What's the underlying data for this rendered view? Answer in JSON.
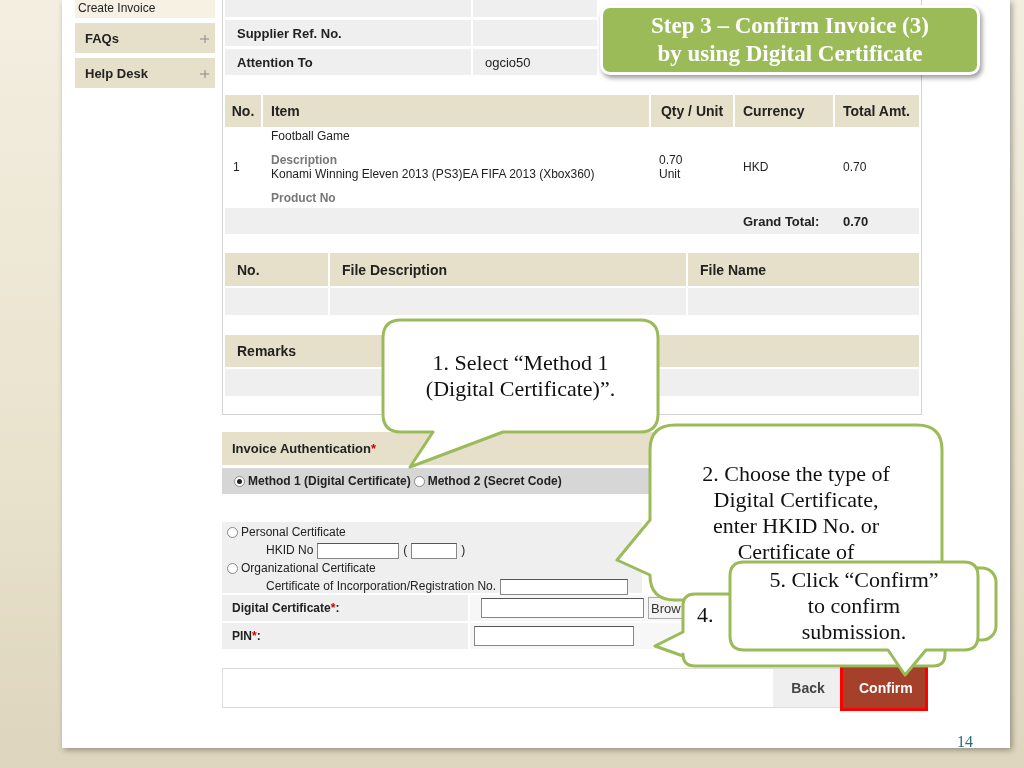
{
  "slide": {
    "title_lines": [
      "Step 3 – Confirm Invoice (3)",
      "by using Digital Certificate"
    ],
    "page_number": "14"
  },
  "sidebar": {
    "items": [
      {
        "label": "Create Invoice",
        "kind": "link"
      },
      {
        "label": "FAQs",
        "kind": "menu"
      },
      {
        "label": "Help Desk",
        "kind": "menu"
      }
    ]
  },
  "header_fields": [
    {
      "label": "Supplier Ref. No."
    },
    {
      "label": "Attention To",
      "value": "ogcio50"
    }
  ],
  "items_table": {
    "columns": [
      "No.",
      "Item",
      "Qty / Unit",
      "Currency",
      "Total Amt."
    ],
    "rows": [
      {
        "no": "1",
        "name": "Football Game",
        "description_label": "Description",
        "description": "Konami Winning Eleven 2013 (PS3)EA FIFA 2013 (Xbox360)",
        "product_no_label": "Product No",
        "qty": "0.70",
        "unit": "Unit",
        "currency": "HKD",
        "total": "0.70"
      }
    ],
    "grand_total_label": "Grand Total:",
    "grand_total": "0.70"
  },
  "attachments_table": {
    "columns": [
      "No.",
      "File Description",
      "File Name"
    ]
  },
  "remarks": {
    "label": "Remarks"
  },
  "authentication": {
    "title": "Invoice Authentication",
    "required_mark": "*",
    "methods": [
      {
        "label": "Method 1 (Digital Certificate)",
        "selected": true
      },
      {
        "label": "Method 2 (Secret Code)",
        "selected": false
      }
    ],
    "certificate_types": [
      {
        "kind": "hkid",
        "label": "Personal Certificate",
        "selected": false,
        "field_label": "HKID No",
        "open": "(",
        "close": ")"
      },
      {
        "kind": "registration",
        "label": "Organizational Certificate",
        "selected": false,
        "field_label": "Certificate of Incorporation/Registration No."
      }
    ],
    "fields": [
      {
        "kind": "file",
        "label": "Digital Certificate",
        "required_mark": "*",
        "suffix": ":",
        "button": "Brow"
      },
      {
        "kind": "password",
        "label": "PIN",
        "required_mark": "*",
        "suffix": ":"
      }
    ]
  },
  "buttons": [
    {
      "label": "Back",
      "kind": "secondary",
      "highlighted": false
    },
    {
      "label": "Confirm",
      "kind": "primary",
      "highlighted": true
    }
  ],
  "callouts": [
    {
      "lines": [
        "1. Select “Method 1",
        "(Digital Certificate)”."
      ]
    },
    {
      "lines": [
        "2. Choose the type of",
        "Digital Certificate,",
        "enter HKID No. or",
        "Certificate of"
      ]
    },
    {
      "lines": [
        "4."
      ]
    },
    {
      "lines": [
        "5. Click “Confirm”",
        "to confirm",
        "submission."
      ]
    }
  ]
}
